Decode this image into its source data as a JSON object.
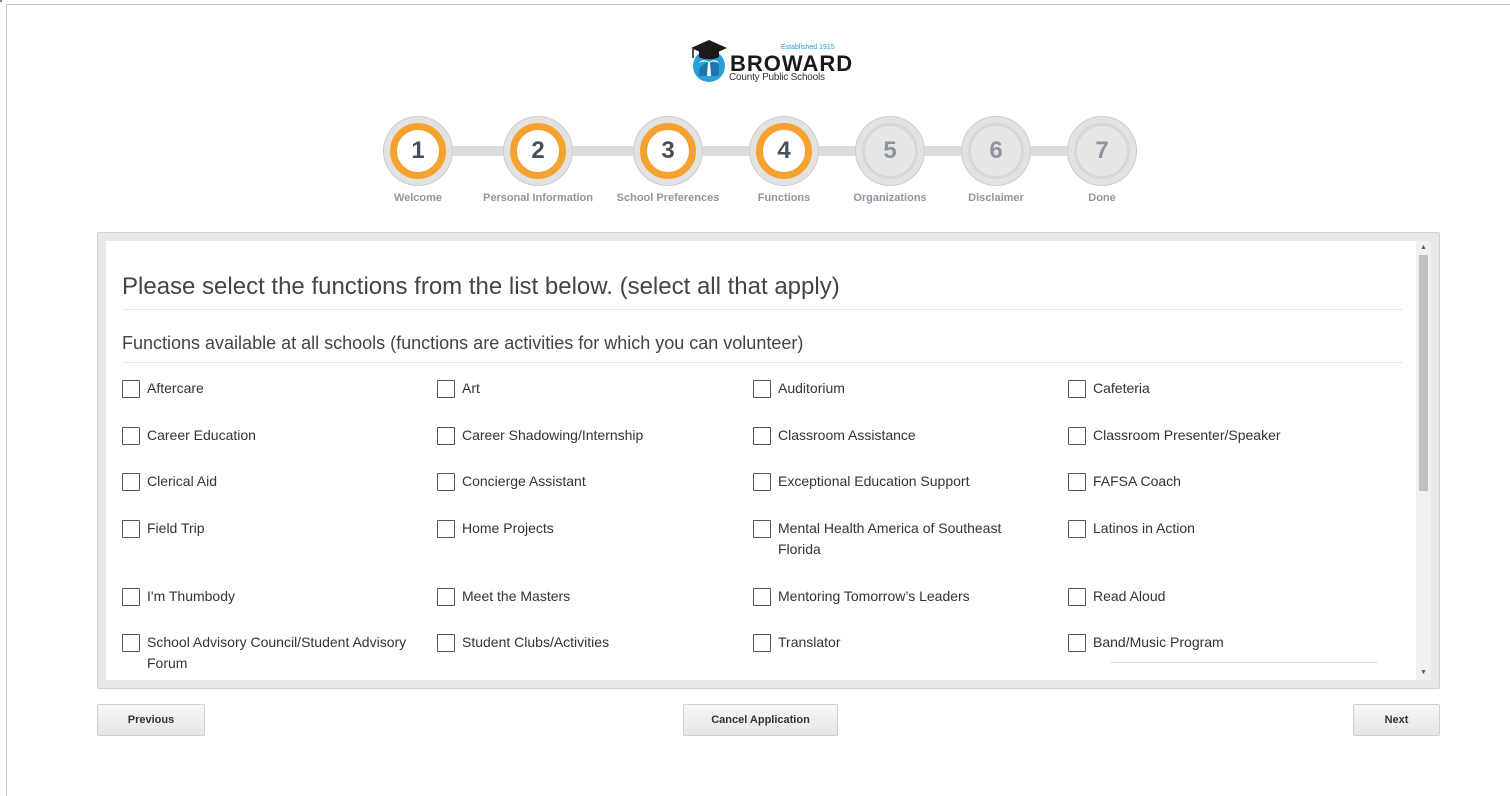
{
  "logo": {
    "established": "Established 1915",
    "name": "BROWARD",
    "subtitle": "County Public Schools"
  },
  "steps": [
    {
      "number": "1",
      "label": "Welcome",
      "state": "completed"
    },
    {
      "number": "2",
      "label": "Personal Information",
      "state": "completed"
    },
    {
      "number": "3",
      "label": "School Preferences",
      "state": "completed"
    },
    {
      "number": "4",
      "label": "Functions",
      "state": "current"
    },
    {
      "number": "5",
      "label": "Organizations",
      "state": "upcoming"
    },
    {
      "number": "6",
      "label": "Disclaimer",
      "state": "upcoming"
    },
    {
      "number": "7",
      "label": "Done",
      "state": "upcoming"
    }
  ],
  "colors": {
    "accent": "#f5a230",
    "step_number": "#47505a",
    "step_label": "#8d96a0"
  },
  "form": {
    "heading": "Please select the functions from the list below. (select all that apply)",
    "subheading": "Functions available at all schools (functions are activities for which you can volunteer)",
    "functions": [
      {
        "label": "Aftercare",
        "checked": false
      },
      {
        "label": "Art",
        "checked": false
      },
      {
        "label": "Auditorium",
        "checked": false
      },
      {
        "label": "Cafeteria",
        "checked": false
      },
      {
        "label": "Career Education",
        "checked": false
      },
      {
        "label": "Career Shadowing/Internship",
        "checked": false
      },
      {
        "label": "Classroom Assistance",
        "checked": false
      },
      {
        "label": "Classroom Presenter/Speaker",
        "checked": false
      },
      {
        "label": "Clerical Aid",
        "checked": false
      },
      {
        "label": "Concierge Assistant",
        "checked": false
      },
      {
        "label": "Exceptional Education Support",
        "checked": false
      },
      {
        "label": "FAFSA Coach",
        "checked": false
      },
      {
        "label": "Field Trip",
        "checked": false
      },
      {
        "label": "Home Projects",
        "checked": false
      },
      {
        "label": "Mental Health America of Southeast Florida",
        "checked": false
      },
      {
        "label": "Latinos in Action",
        "checked": false
      },
      {
        "label": "I'm Thumbody",
        "checked": false
      },
      {
        "label": "Meet the Masters",
        "checked": false
      },
      {
        "label": "Mentoring Tomorrow’s Leaders",
        "checked": false
      },
      {
        "label": "Read Aloud",
        "checked": false
      },
      {
        "label": "School Advisory Council/Student Advisory Forum",
        "checked": false
      },
      {
        "label": "Student Clubs/Activities",
        "checked": false
      },
      {
        "label": "Translator",
        "checked": false
      },
      {
        "label": "Band/Music Program",
        "checked": false
      }
    ]
  },
  "icons": {
    "scroll_up": "scroll-up-arrow-icon",
    "scroll_down": "scroll-down-arrow-icon",
    "checkbox": "checkbox-icon"
  },
  "buttons": {
    "previous": "Previous",
    "cancel": "Cancel Application",
    "next": "Next"
  }
}
